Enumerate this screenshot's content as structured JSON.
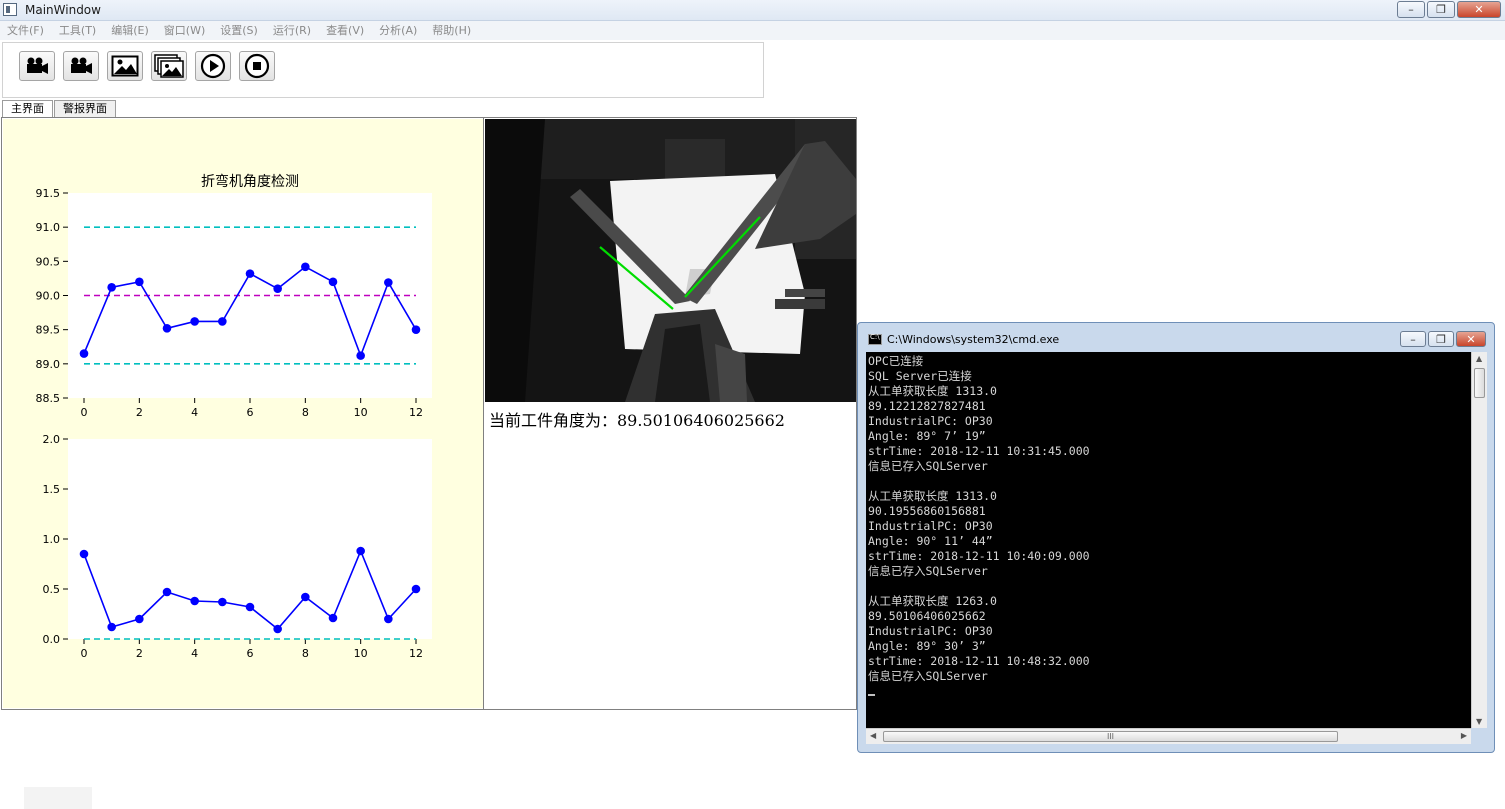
{
  "window": {
    "title": "MainWindow",
    "btn_min": "–",
    "btn_max": "❐",
    "btn_close": "✕"
  },
  "menu": [
    "文件(F)",
    "工具(T)",
    "编辑(E)",
    "窗口(W)",
    "设置(S)",
    "运行(R)",
    "查看(V)",
    "分析(A)",
    "帮助(H)"
  ],
  "toolbar": [
    {
      "name": "camera-1-button",
      "icon": "video-camera-icon"
    },
    {
      "name": "camera-2-button",
      "icon": "video-camera-icon"
    },
    {
      "name": "image-button",
      "icon": "image-icon"
    },
    {
      "name": "gallery-button",
      "icon": "images-icon"
    },
    {
      "name": "play-button",
      "icon": "play-icon"
    },
    {
      "name": "stop-button",
      "icon": "stop-icon"
    }
  ],
  "tabs": [
    "主界面",
    "警报界面"
  ],
  "active_tab": 0,
  "current_angle_text": "当前工件角度为：89.50106406025662",
  "colors": {
    "series": "#0000ff",
    "limits": "#00bfbf",
    "target": "#bf00bf",
    "chart_bg": "#ffffe0"
  },
  "chart_data": [
    {
      "type": "line",
      "title": "折弯机角度检测",
      "x": [
        0,
        1,
        2,
        3,
        4,
        5,
        6,
        7,
        8,
        9,
        10,
        11,
        12
      ],
      "series": [
        {
          "values": [
            89.15,
            90.12,
            90.2,
            89.52,
            89.62,
            89.62,
            90.32,
            90.1,
            90.42,
            90.2,
            89.12,
            90.19,
            89.5
          ]
        }
      ],
      "reference_lines": [
        {
          "y": 91.0,
          "style": "dashed",
          "color": "#00bfbf"
        },
        {
          "y": 90.0,
          "style": "dashed",
          "color": "#bf00bf"
        },
        {
          "y": 89.0,
          "style": "dashed",
          "color": "#00bfbf"
        }
      ],
      "xlim": [
        0,
        12
      ],
      "ylim": [
        88.5,
        91.5
      ],
      "xticks": [
        "0",
        "2",
        "4",
        "6",
        "8",
        "10",
        "12"
      ],
      "yticks": [
        "88.5",
        "89.0",
        "89.5",
        "90.0",
        "90.5",
        "91.0",
        "91.5"
      ]
    },
    {
      "type": "line",
      "title": "",
      "x": [
        0,
        1,
        2,
        3,
        4,
        5,
        6,
        7,
        8,
        9,
        10,
        11,
        12
      ],
      "series": [
        {
          "values": [
            0.85,
            0.12,
            0.2,
            0.47,
            0.38,
            0.37,
            0.32,
            0.1,
            0.42,
            0.21,
            0.88,
            0.2,
            0.5
          ]
        }
      ],
      "reference_lines": [
        {
          "y": 0.0,
          "style": "dashed",
          "color": "#00bfbf"
        }
      ],
      "xlim": [
        0,
        12
      ],
      "ylim": [
        0,
        2.0
      ],
      "xticks": [
        "0",
        "2",
        "4",
        "6",
        "8",
        "10",
        "12"
      ],
      "yticks": [
        "0.0",
        "0.5",
        "1.0",
        "1.5",
        "2.0"
      ]
    }
  ],
  "console": {
    "title": "C:\\Windows\\system32\\cmd.exe",
    "lines": [
      "OPC已连接",
      "SQL Server已连接",
      "从工单获取长度 1313.0",
      "89.12212827827481",
      "IndustrialPC: OP30",
      "Angle: 89° 7’ 19”",
      "strTime: 2018-12-11 10:31:45.000",
      "信息已存入SQLServer",
      "",
      "从工单获取长度 1313.0",
      "90.19556860156881",
      "IndustrialPC: OP30",
      "Angle: 90° 11’ 44”",
      "strTime: 2018-12-11 10:40:09.000",
      "信息已存入SQLServer",
      "",
      "从工单获取长度 1263.0",
      "89.50106406025662",
      "IndustrialPC: OP30",
      "Angle: 89° 30’ 3”",
      "strTime: 2018-12-11 10:48:32.000",
      "信息已存入SQLServer"
    ],
    "hscroll_grip": "III"
  }
}
